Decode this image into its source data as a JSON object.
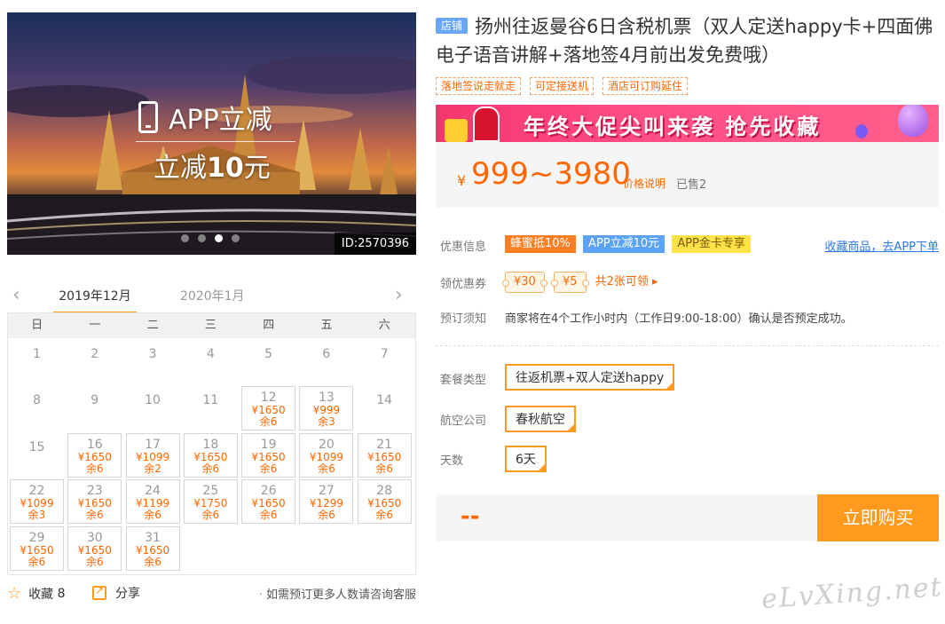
{
  "hero": {
    "app_label": "APP立减",
    "minus_prefix": "立减",
    "minus_amount": "10",
    "minus_unit": "元",
    "id_tag": "ID:2570396",
    "slides": 4,
    "active_slide": 3
  },
  "calendar": {
    "active_month": "2019年12月",
    "next_month": "2020年1月",
    "weekdays": [
      "日",
      "一",
      "二",
      "三",
      "四",
      "五",
      "六"
    ],
    "days": [
      {
        "d": "1"
      },
      {
        "d": "2"
      },
      {
        "d": "3"
      },
      {
        "d": "4"
      },
      {
        "d": "5"
      },
      {
        "d": "6"
      },
      {
        "d": "7"
      },
      {
        "d": "8"
      },
      {
        "d": "9"
      },
      {
        "d": "10"
      },
      {
        "d": "11"
      },
      {
        "d": "12",
        "p": "¥1650",
        "s": "余6"
      },
      {
        "d": "13",
        "p": "¥999",
        "s": "余3"
      },
      {
        "d": "14"
      },
      {
        "d": "15"
      },
      {
        "d": "16",
        "p": "¥1650",
        "s": "余6"
      },
      {
        "d": "17",
        "p": "¥1099",
        "s": "余2"
      },
      {
        "d": "18",
        "p": "¥1650",
        "s": "余6"
      },
      {
        "d": "19",
        "p": "¥1650",
        "s": "余6"
      },
      {
        "d": "20",
        "p": "¥1099",
        "s": "余6"
      },
      {
        "d": "21",
        "p": "¥1650",
        "s": "余6"
      },
      {
        "d": "22",
        "p": "¥1099",
        "s": "余3"
      },
      {
        "d": "23",
        "p": "¥1650",
        "s": "余6"
      },
      {
        "d": "24",
        "p": "¥1199",
        "s": "余6"
      },
      {
        "d": "25",
        "p": "¥1750",
        "s": "余6"
      },
      {
        "d": "26",
        "p": "¥1650",
        "s": "余6"
      },
      {
        "d": "27",
        "p": "¥1299",
        "s": "余6"
      },
      {
        "d": "28",
        "p": "¥1650",
        "s": "余6"
      },
      {
        "d": "29",
        "p": "¥1650",
        "s": "余6"
      },
      {
        "d": "30",
        "p": "¥1650",
        "s": "余6"
      },
      {
        "d": "31",
        "p": "¥1650",
        "s": "余6"
      }
    ]
  },
  "footer_left": {
    "fav_label": "收藏",
    "fav_count": "8",
    "share_label": "分享",
    "hint": "如需预订更多人数请咨询客服"
  },
  "product": {
    "shop_badge": "店铺",
    "title": "扬州往返曼谷6日含税机票（双人定送happy卡+四面佛电子语音讲解+落地签4月前出发免费哦）",
    "tags": [
      "落地签说走就走",
      "可定接送机",
      "酒店可订购延住"
    ],
    "banner_text": "年终大促尖叫来袭  抢先收藏",
    "price_symbol": "¥",
    "price_range": "999~3980",
    "price_explain": "价格说明",
    "sold": "已售2"
  },
  "offers": {
    "label": "优惠信息",
    "badges": [
      "蜂蜜抵10%",
      "APP立减10元",
      "APP金卡专享"
    ],
    "collect_link": "收藏商品，去APP下单"
  },
  "coupons": {
    "label": "领优惠券",
    "items": [
      "¥30",
      "¥5"
    ],
    "more": "共2张可领 ▸"
  },
  "notice": {
    "label": "预订须知",
    "text": "商家将在4个工作小时内（工作日9:00-18:00）确认是否预定成功。"
  },
  "options": {
    "package_label": "套餐类型",
    "package_value": "往返机票+双人定送happy",
    "airline_label": "航空公司",
    "airline_value": "春秋航空",
    "days_label": "天数",
    "days_value": "6天"
  },
  "buy": {
    "total": "--",
    "button": "立即购买"
  },
  "watermark": "eLvXing.net",
  "colors": {
    "accent": "#ff9a1e",
    "price": "#ff6600",
    "link": "#2a7ae2"
  }
}
